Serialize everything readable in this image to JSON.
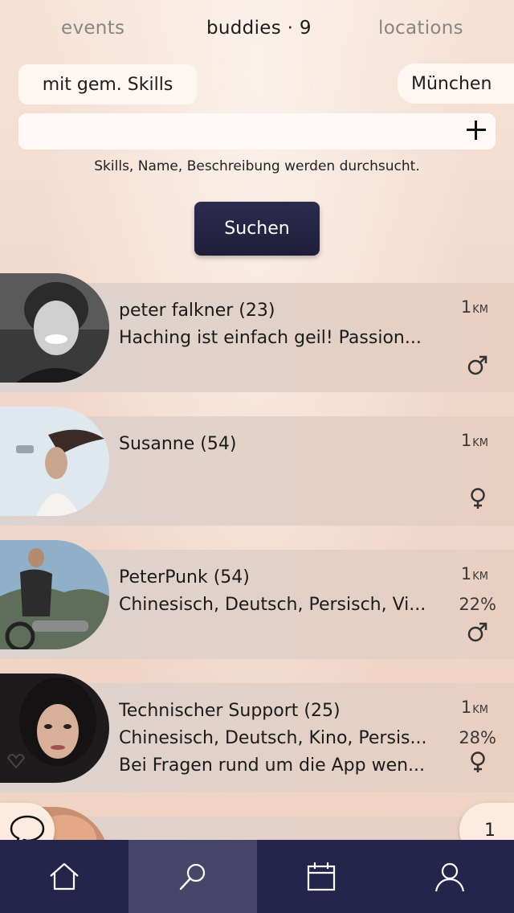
{
  "tabs": {
    "events": "events",
    "buddies": "buddies · 9",
    "locations": "locations"
  },
  "filters": {
    "skills_chip": "mit gem. Skills",
    "city_chip": "München"
  },
  "search": {
    "value": "",
    "hint": "Skills, Name, Beschreibung werden durchsucht.",
    "button_label": "Suchen"
  },
  "buddies": [
    {
      "name": "peter falkner (23)",
      "line2": "Haching ist einfach geil! Passion...",
      "line3": "",
      "distance": "1",
      "unit": "KM",
      "match": "",
      "gender": "male"
    },
    {
      "name": "Susanne (54)",
      "line2": "",
      "line3": "",
      "distance": "1",
      "unit": "KM",
      "match": "",
      "gender": "female"
    },
    {
      "name": "PeterPunk (54)",
      "line2": "Chinesisch, Deutsch, Persisch, Vi...",
      "line3": "",
      "distance": "1",
      "unit": "KM",
      "match": "22%",
      "gender": "male"
    },
    {
      "name": "Technischer Support (25)",
      "line2": "Chinesisch, Deutsch, Kino, Persis...",
      "line3": "Bei Fragen rund um die App wen...",
      "distance": "1",
      "unit": "KM",
      "match": "28%",
      "gender": "female"
    }
  ],
  "fabs": {
    "page_number": "1"
  },
  "icons": {
    "chat": "chat-bubble-icon",
    "home": "home-icon",
    "search": "search-icon",
    "calendar": "calendar-icon",
    "profile": "user-icon",
    "plus": "plus-icon",
    "male": "male-icon",
    "female": "female-icon"
  },
  "colors": {
    "nav_background": "#25244a",
    "nav_active": "#474668",
    "button_background": "#25244a"
  }
}
